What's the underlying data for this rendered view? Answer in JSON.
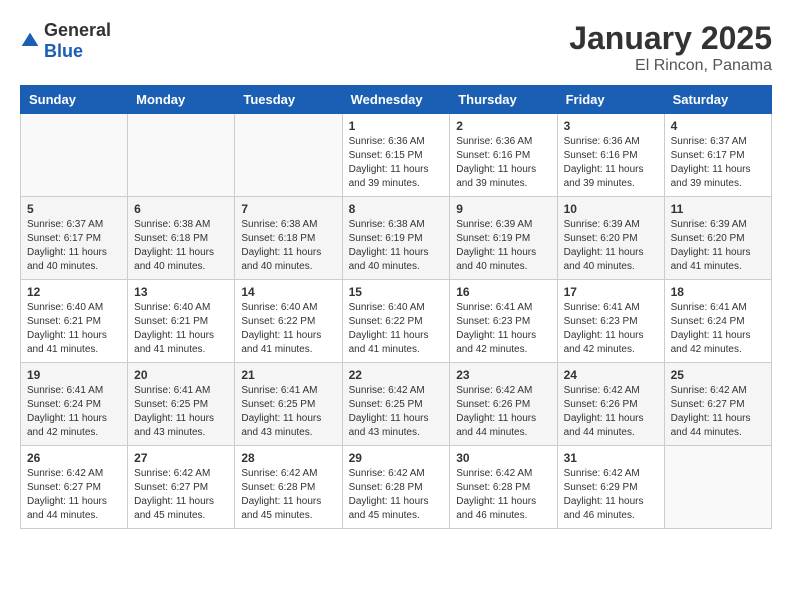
{
  "logo": {
    "general": "General",
    "blue": "Blue"
  },
  "header": {
    "month": "January 2025",
    "location": "El Rincon, Panama"
  },
  "weekdays": [
    "Sunday",
    "Monday",
    "Tuesday",
    "Wednesday",
    "Thursday",
    "Friday",
    "Saturday"
  ],
  "weeks": [
    [
      {
        "day": "",
        "info": ""
      },
      {
        "day": "",
        "info": ""
      },
      {
        "day": "",
        "info": ""
      },
      {
        "day": "1",
        "info": "Sunrise: 6:36 AM\nSunset: 6:15 PM\nDaylight: 11 hours and 39 minutes."
      },
      {
        "day": "2",
        "info": "Sunrise: 6:36 AM\nSunset: 6:16 PM\nDaylight: 11 hours and 39 minutes."
      },
      {
        "day": "3",
        "info": "Sunrise: 6:36 AM\nSunset: 6:16 PM\nDaylight: 11 hours and 39 minutes."
      },
      {
        "day": "4",
        "info": "Sunrise: 6:37 AM\nSunset: 6:17 PM\nDaylight: 11 hours and 39 minutes."
      }
    ],
    [
      {
        "day": "5",
        "info": "Sunrise: 6:37 AM\nSunset: 6:17 PM\nDaylight: 11 hours and 40 minutes."
      },
      {
        "day": "6",
        "info": "Sunrise: 6:38 AM\nSunset: 6:18 PM\nDaylight: 11 hours and 40 minutes."
      },
      {
        "day": "7",
        "info": "Sunrise: 6:38 AM\nSunset: 6:18 PM\nDaylight: 11 hours and 40 minutes."
      },
      {
        "day": "8",
        "info": "Sunrise: 6:38 AM\nSunset: 6:19 PM\nDaylight: 11 hours and 40 minutes."
      },
      {
        "day": "9",
        "info": "Sunrise: 6:39 AM\nSunset: 6:19 PM\nDaylight: 11 hours and 40 minutes."
      },
      {
        "day": "10",
        "info": "Sunrise: 6:39 AM\nSunset: 6:20 PM\nDaylight: 11 hours and 40 minutes."
      },
      {
        "day": "11",
        "info": "Sunrise: 6:39 AM\nSunset: 6:20 PM\nDaylight: 11 hours and 41 minutes."
      }
    ],
    [
      {
        "day": "12",
        "info": "Sunrise: 6:40 AM\nSunset: 6:21 PM\nDaylight: 11 hours and 41 minutes."
      },
      {
        "day": "13",
        "info": "Sunrise: 6:40 AM\nSunset: 6:21 PM\nDaylight: 11 hours and 41 minutes."
      },
      {
        "day": "14",
        "info": "Sunrise: 6:40 AM\nSunset: 6:22 PM\nDaylight: 11 hours and 41 minutes."
      },
      {
        "day": "15",
        "info": "Sunrise: 6:40 AM\nSunset: 6:22 PM\nDaylight: 11 hours and 41 minutes."
      },
      {
        "day": "16",
        "info": "Sunrise: 6:41 AM\nSunset: 6:23 PM\nDaylight: 11 hours and 42 minutes."
      },
      {
        "day": "17",
        "info": "Sunrise: 6:41 AM\nSunset: 6:23 PM\nDaylight: 11 hours and 42 minutes."
      },
      {
        "day": "18",
        "info": "Sunrise: 6:41 AM\nSunset: 6:24 PM\nDaylight: 11 hours and 42 minutes."
      }
    ],
    [
      {
        "day": "19",
        "info": "Sunrise: 6:41 AM\nSunset: 6:24 PM\nDaylight: 11 hours and 42 minutes."
      },
      {
        "day": "20",
        "info": "Sunrise: 6:41 AM\nSunset: 6:25 PM\nDaylight: 11 hours and 43 minutes."
      },
      {
        "day": "21",
        "info": "Sunrise: 6:41 AM\nSunset: 6:25 PM\nDaylight: 11 hours and 43 minutes."
      },
      {
        "day": "22",
        "info": "Sunrise: 6:42 AM\nSunset: 6:25 PM\nDaylight: 11 hours and 43 minutes."
      },
      {
        "day": "23",
        "info": "Sunrise: 6:42 AM\nSunset: 6:26 PM\nDaylight: 11 hours and 44 minutes."
      },
      {
        "day": "24",
        "info": "Sunrise: 6:42 AM\nSunset: 6:26 PM\nDaylight: 11 hours and 44 minutes."
      },
      {
        "day": "25",
        "info": "Sunrise: 6:42 AM\nSunset: 6:27 PM\nDaylight: 11 hours and 44 minutes."
      }
    ],
    [
      {
        "day": "26",
        "info": "Sunrise: 6:42 AM\nSunset: 6:27 PM\nDaylight: 11 hours and 44 minutes."
      },
      {
        "day": "27",
        "info": "Sunrise: 6:42 AM\nSunset: 6:27 PM\nDaylight: 11 hours and 45 minutes."
      },
      {
        "day": "28",
        "info": "Sunrise: 6:42 AM\nSunset: 6:28 PM\nDaylight: 11 hours and 45 minutes."
      },
      {
        "day": "29",
        "info": "Sunrise: 6:42 AM\nSunset: 6:28 PM\nDaylight: 11 hours and 45 minutes."
      },
      {
        "day": "30",
        "info": "Sunrise: 6:42 AM\nSunset: 6:28 PM\nDaylight: 11 hours and 46 minutes."
      },
      {
        "day": "31",
        "info": "Sunrise: 6:42 AM\nSunset: 6:29 PM\nDaylight: 11 hours and 46 minutes."
      },
      {
        "day": "",
        "info": ""
      }
    ]
  ]
}
